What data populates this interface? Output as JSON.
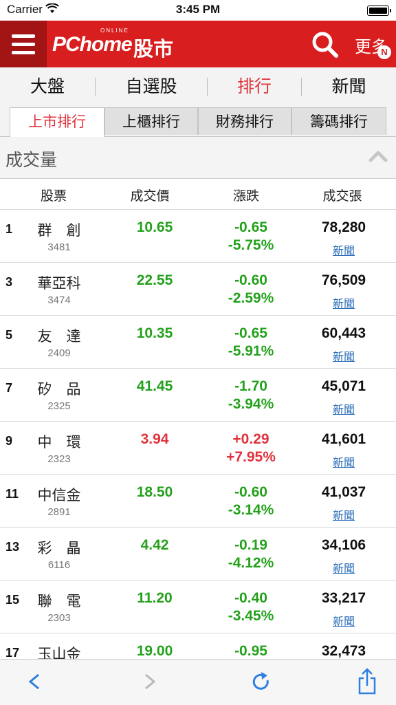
{
  "status_bar": {
    "carrier": "Carrier",
    "time": "3:45 PM",
    "wifi_icon": "wifi-icon",
    "battery_icon": "battery-icon"
  },
  "header": {
    "menu_icon": "hamburger-menu-icon",
    "logo_online": "ONLINE",
    "logo_brand": "PChome",
    "logo_cn": "股市",
    "search_icon": "search-icon",
    "more_label": "更多",
    "badge": "N",
    "bg_color": "#d81e1e"
  },
  "main_tabs": [
    {
      "label": "大盤",
      "active": false
    },
    {
      "label": "自選股",
      "active": false
    },
    {
      "label": "排行",
      "active": true
    },
    {
      "label": "新聞",
      "active": false
    }
  ],
  "sub_tabs": [
    {
      "label": "上市排行",
      "active": true
    },
    {
      "label": "上櫃排行",
      "active": false
    },
    {
      "label": "財務排行",
      "active": false
    },
    {
      "label": "籌碼排行",
      "active": false
    }
  ],
  "section": {
    "title": "成交量",
    "collapse_icon": "chevron-up-icon"
  },
  "table": {
    "headers": [
      "股票",
      "成交價",
      "漲跌",
      "成交張"
    ],
    "rows": [
      {
        "rank": "1",
        "name": "群　創",
        "code": "3481",
        "price": "10.65",
        "change": "-0.65",
        "percent": "-5.75%",
        "volume": "78,280",
        "news": "新聞",
        "dir": "down"
      },
      {
        "rank": "3",
        "name": "華亞科",
        "code": "3474",
        "price": "22.55",
        "change": "-0.60",
        "percent": "-2.59%",
        "volume": "76,509",
        "news": "新聞",
        "dir": "down"
      },
      {
        "rank": "5",
        "name": "友　達",
        "code": "2409",
        "price": "10.35",
        "change": "-0.65",
        "percent": "-5.91%",
        "volume": "60,443",
        "news": "新聞",
        "dir": "down"
      },
      {
        "rank": "7",
        "name": "矽　品",
        "code": "2325",
        "price": "41.45",
        "change": "-1.70",
        "percent": "-3.94%",
        "volume": "45,071",
        "news": "新聞",
        "dir": "down"
      },
      {
        "rank": "9",
        "name": "中　環",
        "code": "2323",
        "price": "3.94",
        "change": "+0.29",
        "percent": "+7.95%",
        "volume": "41,601",
        "news": "新聞",
        "dir": "up"
      },
      {
        "rank": "11",
        "name": "中信金",
        "code": "2891",
        "price": "18.50",
        "change": "-0.60",
        "percent": "-3.14%",
        "volume": "41,037",
        "news": "新聞",
        "dir": "down"
      },
      {
        "rank": "13",
        "name": "彩　晶",
        "code": "6116",
        "price": "4.42",
        "change": "-0.19",
        "percent": "-4.12%",
        "volume": "34,106",
        "news": "新聞",
        "dir": "down"
      },
      {
        "rank": "15",
        "name": "聯　電",
        "code": "2303",
        "price": "11.20",
        "change": "-0.40",
        "percent": "-3.45%",
        "volume": "33,217",
        "news": "新聞",
        "dir": "down"
      },
      {
        "rank": "17",
        "name": "玉山金",
        "code": "",
        "price": "19.00",
        "change": "-0.95",
        "percent": "",
        "volume": "32,473",
        "news": "",
        "dir": "down"
      }
    ]
  },
  "toolbar": {
    "back_icon": "back-chevron-icon",
    "forward_icon": "forward-chevron-icon",
    "reload_icon": "reload-icon",
    "share_icon": "share-icon"
  },
  "colors": {
    "up": "#e0323c",
    "down": "#23a11b",
    "link": "#2a6db8",
    "active_tab": "#e0323c"
  }
}
